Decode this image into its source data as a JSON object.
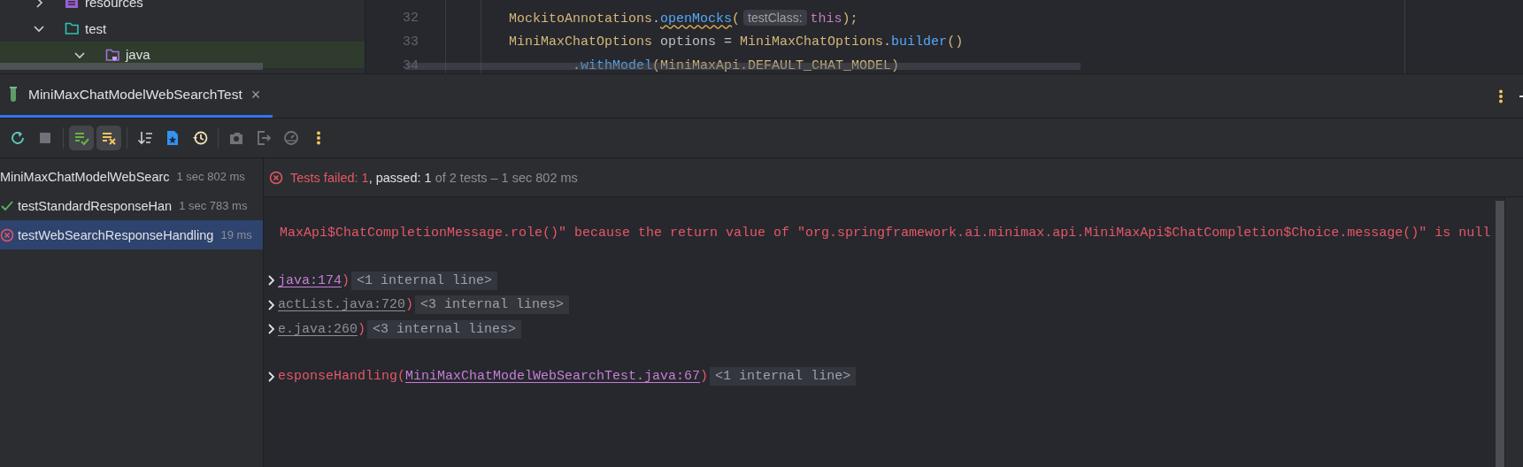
{
  "project_tree": [
    {
      "label": "resources",
      "kind": "resources",
      "expanded": false,
      "selected": false
    },
    {
      "label": "test",
      "kind": "test",
      "expanded": true,
      "selected": false,
      "children": [
        {
          "label": "java",
          "kind": "java",
          "expanded": true,
          "selected": true
        }
      ]
    }
  ],
  "editor": {
    "lines": [
      {
        "number": "32",
        "tokens": [
          {
            "text": "MockitoAnnotations",
            "kind": "type",
            "warning": false
          },
          {
            "text": ".",
            "kind": "punct",
            "warning": false
          },
          {
            "text": "openMocks",
            "kind": "method",
            "warning": true
          },
          {
            "text": "(",
            "kind": "type",
            "warning": false
          },
          {
            "text": "testClass:",
            "kind": "hint",
            "warning": false
          },
          {
            "text": "this",
            "kind": "keyword",
            "warning": false
          },
          {
            "text": ");",
            "kind": "type",
            "warning": false
          }
        ]
      },
      {
        "number": "33",
        "tokens": [
          {
            "text": "MiniMaxChatOptions",
            "kind": "type",
            "warning": false
          },
          {
            "text": " options = ",
            "kind": "ident",
            "warning": false
          },
          {
            "text": "MiniMaxChatOptions",
            "kind": "type",
            "warning": false
          },
          {
            "text": ".",
            "kind": "punct",
            "warning": false
          },
          {
            "text": "builder",
            "kind": "method",
            "warning": false
          },
          {
            "text": "()",
            "kind": "type",
            "warning": false
          }
        ],
        "children": [
          {
            "number": "34",
            "tokens": [
              {
                "text": ".",
                "kind": "punct",
                "warning": false
              },
              {
                "text": "withModel",
                "kind": "method",
                "warning": false
              },
              {
                "text": "(MiniMaxApi.DEFAULT_CHAT_MODEL)",
                "kind": "type",
                "warning": false
              }
            ]
          }
        ]
      }
    ]
  },
  "run_tabs": [
    {
      "label": "MiniMaxChatModelWebSearchTest",
      "selected": true,
      "close": "×"
    }
  ],
  "toolbar": {
    "groups": [
      [
        {
          "kind": "rerun",
          "on": false,
          "disabled": false
        },
        {
          "kind": "stop",
          "on": false,
          "disabled": true
        }
      ],
      [
        {
          "kind": "show-passed",
          "on": true,
          "disabled": false
        },
        {
          "kind": "show-ignored",
          "on": true,
          "disabled": false
        }
      ],
      [
        {
          "kind": "sort",
          "on": false,
          "disabled": false
        },
        {
          "kind": "import",
          "on": false,
          "disabled": false
        },
        {
          "kind": "history",
          "on": false,
          "disabled": false
        }
      ],
      [
        {
          "kind": "camera",
          "on": false,
          "disabled": true
        },
        {
          "kind": "export",
          "on": false,
          "disabled": true
        },
        {
          "kind": "coverage",
          "on": false,
          "disabled": true
        },
        {
          "kind": "more",
          "on": false,
          "disabled": false
        }
      ]
    ]
  },
  "test_tree": [
    {
      "name": "MiniMaxChatModelWebSearc",
      "time": "1 sec 802 ms",
      "selected": false,
      "children": [
        {
          "name": "testStandardResponseHan",
          "time": "1 sec 783 ms",
          "kind": "passed",
          "selected": false
        },
        {
          "name": "testWebSearchResponseHandling",
          "time": "19 ms",
          "kind": "failed",
          "selected": true
        }
      ]
    }
  ],
  "summary": [
    {
      "text": "Tests failed: 1",
      "kind": "failed"
    },
    {
      "text": ", passed: 1",
      "kind": "passed"
    },
    {
      "text": " of 2 tests – 1 sec 802 ms",
      "kind": "info"
    }
  ],
  "console": [
    {
      "kind": "error",
      "text": "MaxApi$ChatCompletionMessage.role()\" because the return value of \"org.springframework.ai.minimax.api.MiniMaxApi$ChatCompletion$Choice.message()\" is null"
    },
    {
      "kind": "gap"
    },
    {
      "kind": "frame",
      "link": "java:174",
      "in_project": true,
      "suffix": ")",
      "folded": "<1 internal line>"
    },
    {
      "kind": "frame",
      "link": "actList.java:720",
      "in_project": false,
      "suffix": ")",
      "folded": "<3 internal lines>"
    },
    {
      "kind": "frame",
      "link": "e.java:260",
      "in_project": false,
      "suffix": ")",
      "folded": "<3 internal lines>"
    },
    {
      "kind": "gap"
    },
    {
      "kind": "frame",
      "prefix": "esponseHandling(",
      "link": "MiniMaxChatModelWebSearchTest.java:67",
      "in_project": true,
      "suffix": ")",
      "folded": "<1 internal line>"
    }
  ]
}
